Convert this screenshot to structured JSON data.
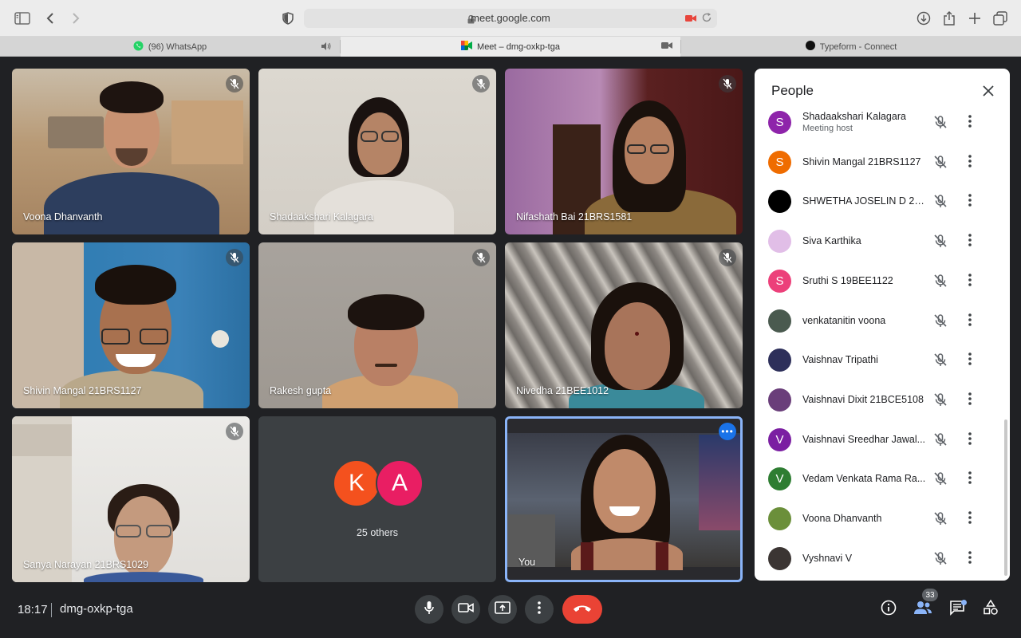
{
  "browser": {
    "url": "meet.google.com",
    "tabs": [
      {
        "label": "(96) WhatsApp",
        "icon": "whatsapp-icon"
      },
      {
        "label": "Meet – dmg-oxkp-tga",
        "icon": "google-meet-icon"
      },
      {
        "label": "Typeform - Connect",
        "icon": "typeform-icon"
      }
    ]
  },
  "tiles": [
    {
      "name": "Voona Dhanvanth"
    },
    {
      "name": "Shadaakshari Kalagara"
    },
    {
      "name": "Nifashath Bai 21BRS1581"
    },
    {
      "name": "Shivin Mangal 21BRS1127"
    },
    {
      "name": "Rakesh gupta"
    },
    {
      "name": "Nivedha 21BEE1012"
    },
    {
      "name": "Sanya Narayan 21BRS1029"
    }
  ],
  "others_tile": {
    "avatars": [
      {
        "letter": "K",
        "color": "#f4511e"
      },
      {
        "letter": "A",
        "color": "#e91e63"
      }
    ],
    "label": "25 others"
  },
  "self_tile": {
    "name": "You"
  },
  "people_panel": {
    "title": "People",
    "participants": [
      {
        "name": "Shadaakshari Kalagara",
        "subtitle": "Meeting host",
        "avatar": "S",
        "color": "#8e24aa"
      },
      {
        "name": "Shivin Mangal 21BRS1127",
        "subtitle": "",
        "avatar": "S",
        "color": "#ef6c00"
      },
      {
        "name": "SHWETHA JOSELIN D 20...",
        "subtitle": "",
        "avatar": "",
        "color": "#000000"
      },
      {
        "name": "Siva Karthika",
        "subtitle": "",
        "avatar": "",
        "color": "#e1bee7"
      },
      {
        "name": "Sruthi S 19BEE1122",
        "subtitle": "",
        "avatar": "S",
        "color": "#ec407a"
      },
      {
        "name": "venkatanitin voona",
        "subtitle": "",
        "avatar": "",
        "color": "#4a5a4f"
      },
      {
        "name": "Vaishnav Tripathi",
        "subtitle": "",
        "avatar": "",
        "color": "#2d2f5a"
      },
      {
        "name": "Vaishnavi Dixit 21BCE5108",
        "subtitle": "",
        "avatar": "",
        "color": "#6a3e7a"
      },
      {
        "name": "Vaishnavi Sreedhar Jawal...",
        "subtitle": "",
        "avatar": "V",
        "color": "#7b1fa2"
      },
      {
        "name": "Vedam Venkata Rama Ra...",
        "subtitle": "",
        "avatar": "V",
        "color": "#2e7d32"
      },
      {
        "name": "Voona Dhanvanth",
        "subtitle": "",
        "avatar": "",
        "color": "#6b8f3a"
      },
      {
        "name": "Vyshnavi V",
        "subtitle": "",
        "avatar": "",
        "color": "#3b3533"
      }
    ]
  },
  "footer": {
    "time": "18:17",
    "meeting_code": "dmg-oxkp-tga",
    "participant_count": "33"
  }
}
